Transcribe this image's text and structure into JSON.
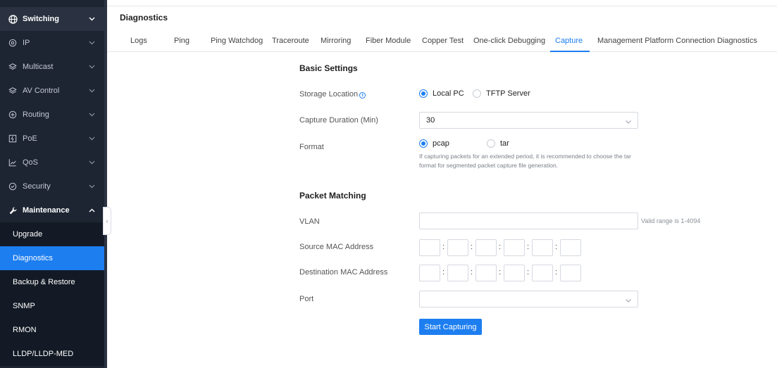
{
  "sidebar": {
    "items": [
      {
        "label": "Switching",
        "icon": "globe-icon",
        "state": "top"
      },
      {
        "label": "IP",
        "icon": "location-icon"
      },
      {
        "label": "Multicast",
        "icon": "layers-icon"
      },
      {
        "label": "AV Control",
        "icon": "layers-icon"
      },
      {
        "label": "Routing",
        "icon": "routing-icon"
      },
      {
        "label": "PoE",
        "icon": "poe-icon"
      },
      {
        "label": "QoS",
        "icon": "chart-icon"
      },
      {
        "label": "Security",
        "icon": "shield-icon"
      },
      {
        "label": "Maintenance",
        "icon": "wrench-icon",
        "state": "open"
      }
    ],
    "sub_items": [
      "Upgrade",
      "Diagnostics",
      "Backup & Restore",
      "SNMP",
      "RMON",
      "LLDP/LLDP-MED"
    ],
    "active_sub": "Diagnostics",
    "chevron_down": "⌄",
    "chevron_up": "⌃",
    "collapse_glyph": "‹"
  },
  "page": {
    "title": "Diagnostics",
    "tabs": [
      "Logs",
      "Ping",
      "Ping Watchdog",
      "Traceroute",
      "Mirroring",
      "Fiber Module",
      "Copper Test",
      "One-click Debugging",
      "Capture",
      "Management Platform Connection Diagnostics"
    ],
    "active_tab": "Capture"
  },
  "basic": {
    "title": "Basic Settings",
    "storage_label": "Storage Location",
    "storage_options": [
      "Local PC",
      "TFTP Server"
    ],
    "storage_selected": "Local PC",
    "duration_label": "Capture Duration (Min)",
    "duration_value": "30",
    "format_label": "Format",
    "format_options": [
      "pcap",
      "tar"
    ],
    "format_selected": "pcap",
    "format_hint": "If capturing packets for an extended period, it is recommended to choose the tar format for segmented packet capture file generation."
  },
  "matching": {
    "title": "Packet Matching",
    "vlan_label": "VLAN",
    "vlan_value": "",
    "vlan_hint": "Valid range is 1-4094",
    "src_mac_label": "Source MAC Address",
    "dst_mac_label": "Destination MAC Address",
    "mac_separator": ":",
    "port_label": "Port",
    "port_value": ""
  },
  "actions": {
    "start_label": "Start Capturing"
  },
  "colors": {
    "accent": "#1d7ef0",
    "sidebar_bg": "#1d2533",
    "sub_bg": "#131a25"
  }
}
